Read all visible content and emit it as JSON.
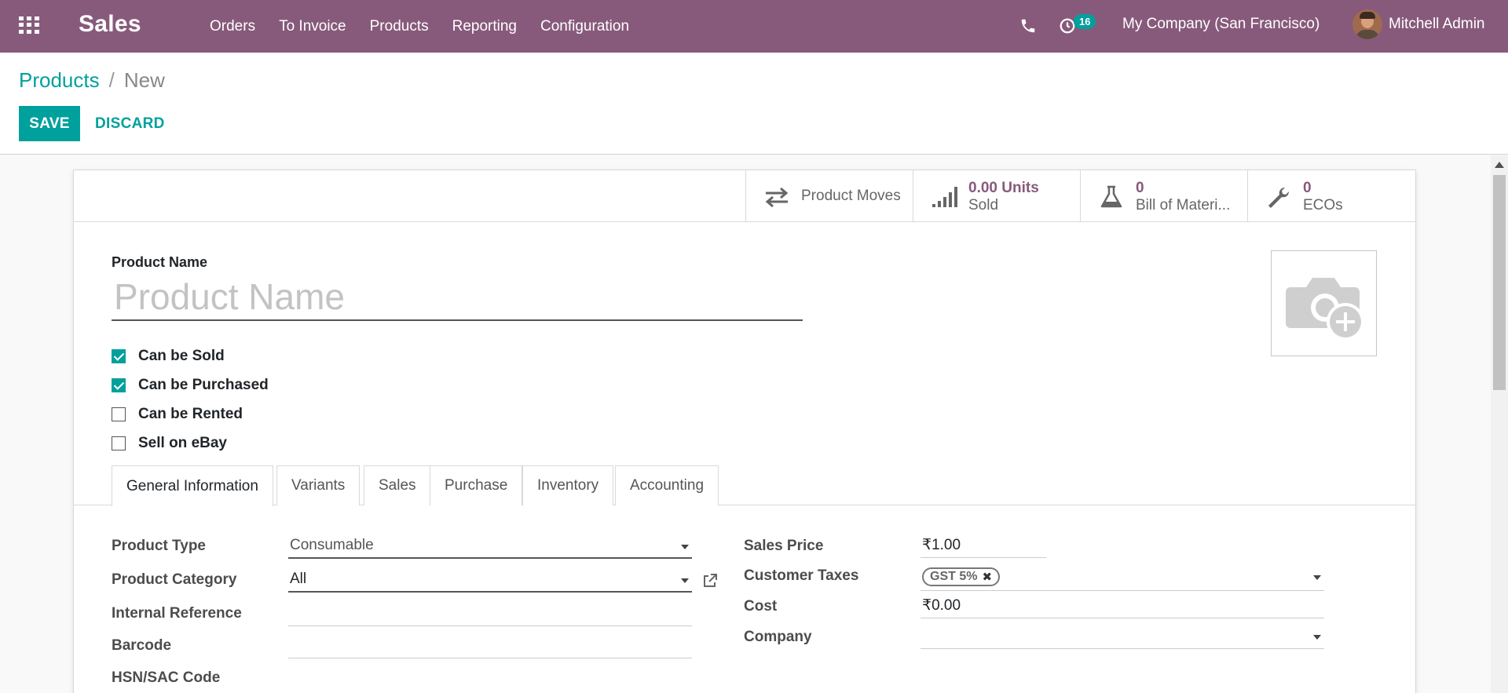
{
  "app": {
    "title": "Sales"
  },
  "nav": {
    "menu": [
      "Orders",
      "To Invoice",
      "Products",
      "Reporting",
      "Configuration"
    ],
    "activity_count": "16",
    "company": "My Company (San Francisco)",
    "user": "Mitchell Admin"
  },
  "breadcrumb": {
    "parent": "Products",
    "separator": "/",
    "current": "New"
  },
  "actions": {
    "save": "SAVE",
    "discard": "DISCARD"
  },
  "smart_buttons": {
    "product_moves": {
      "label": "Product Moves",
      "icon": "exchange-icon"
    },
    "sold": {
      "value": "0.00 Units",
      "label": "Sold",
      "icon": "signal-icon"
    },
    "bom": {
      "value": "0",
      "label": "Bill of Materi...",
      "icon": "flask-icon"
    },
    "ecos": {
      "value": "0",
      "label": "ECOs",
      "icon": "wrench-icon"
    }
  },
  "product": {
    "name_label": "Product Name",
    "name_placeholder": "Product Name",
    "name_value": ""
  },
  "checkboxes": [
    {
      "label": "Can be Sold",
      "checked": true
    },
    {
      "label": "Can be Purchased",
      "checked": true
    },
    {
      "label": "Can be Rented",
      "checked": false
    },
    {
      "label": "Sell on eBay",
      "checked": false
    }
  ],
  "tabs": [
    "General Information",
    "Variants",
    "Sales",
    "Purchase",
    "Inventory",
    "Accounting"
  ],
  "active_tab": "General Information",
  "general": {
    "product_type_label": "Product Type",
    "product_type": "Consumable",
    "product_category_label": "Product Category",
    "product_category": "All",
    "internal_reference_label": "Internal Reference",
    "internal_reference": "",
    "barcode_label": "Barcode",
    "barcode": "",
    "hsn_label": "HSN/SAC Code",
    "sales_price_label": "Sales Price",
    "sales_price": "₹1.00",
    "customer_taxes_label": "Customer Taxes",
    "customer_tax_tag": "GST 5%",
    "cost_label": "Cost",
    "cost": "₹0.00",
    "company_label": "Company",
    "company": ""
  },
  "colors": {
    "brand": "#875a7b",
    "accent": "#00a09d"
  }
}
